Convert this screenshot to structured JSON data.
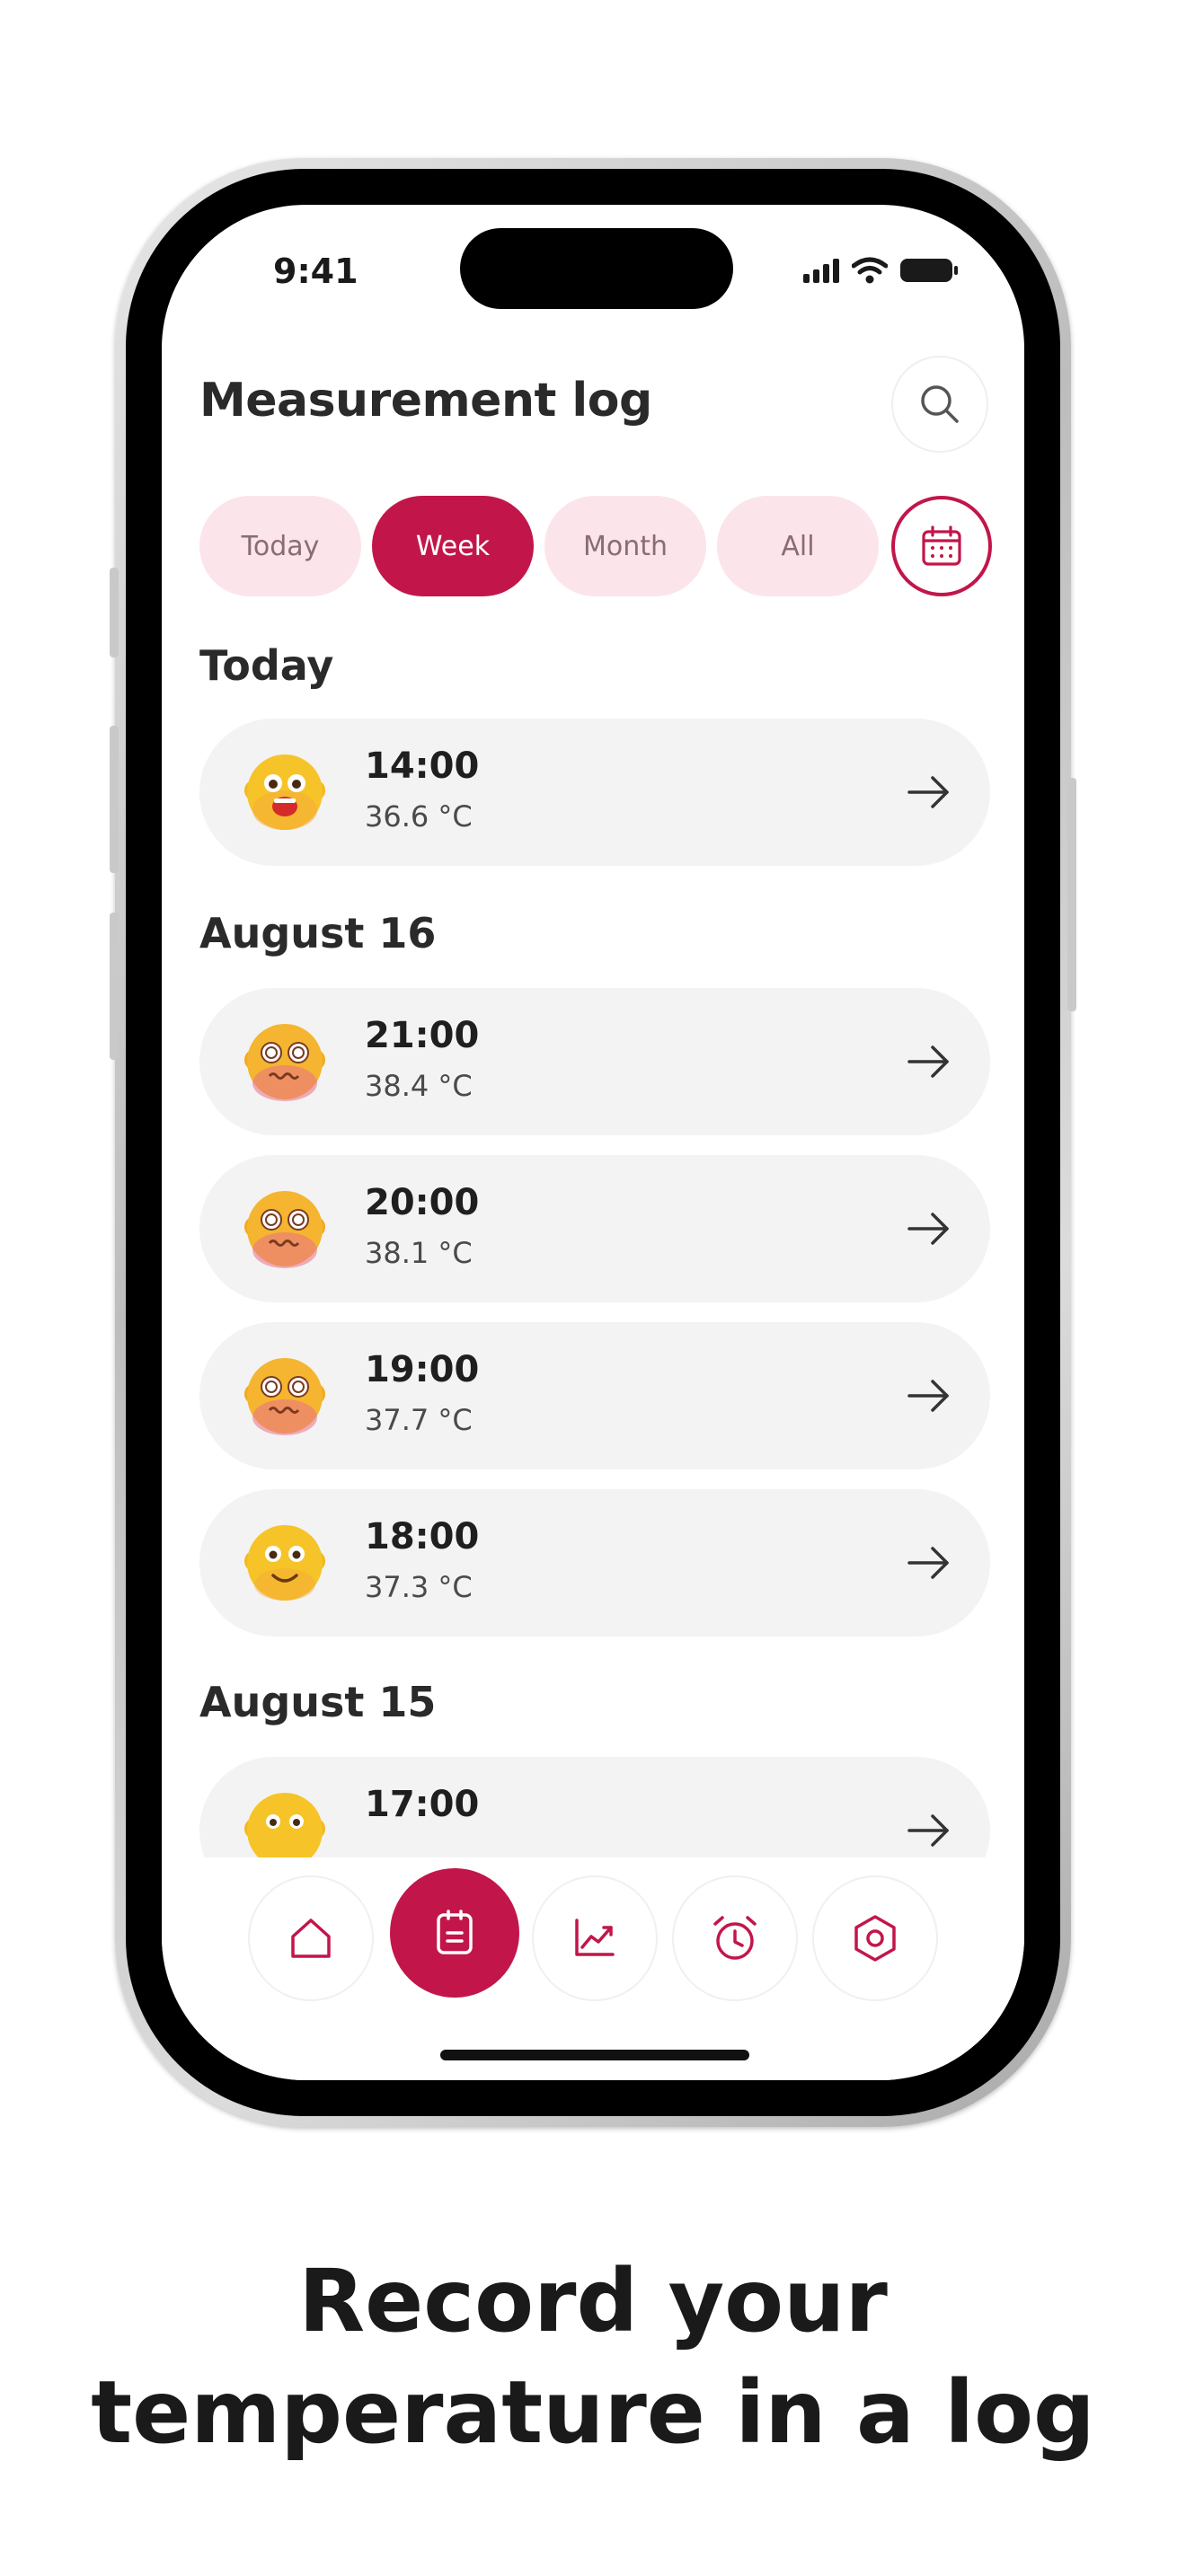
{
  "status_bar": {
    "time": "9:41"
  },
  "header": {
    "title": "Measurement log"
  },
  "filters": {
    "chips": [
      {
        "label": "Today",
        "active": false
      },
      {
        "label": "Week",
        "active": true
      },
      {
        "label": "Month",
        "active": false
      },
      {
        "label": "All",
        "active": false
      }
    ]
  },
  "sections": [
    {
      "title": "Today",
      "entries": [
        {
          "time": "14:00",
          "temp": "36.6 °C",
          "icon": "happy-face-emoji"
        }
      ]
    },
    {
      "title": "August 16",
      "entries": [
        {
          "time": "21:00",
          "temp": "38.4 °C",
          "icon": "dizzy-face-emoji"
        },
        {
          "time": "20:00",
          "temp": "38.1 °C",
          "icon": "dizzy-face-emoji"
        },
        {
          "time": "19:00",
          "temp": "37.7 °C",
          "icon": "dizzy-face-emoji"
        },
        {
          "time": "18:00",
          "temp": "37.3 °C",
          "icon": "smiling-face-emoji"
        }
      ]
    },
    {
      "title": "August 15",
      "entries": [
        {
          "time": "17:00",
          "temp": "",
          "icon": "worried-face-emoji"
        }
      ]
    }
  ],
  "nav": {
    "items": [
      "home-icon",
      "log-icon",
      "chart-icon",
      "alarm-icon",
      "settings-icon"
    ],
    "active": "log-icon"
  },
  "colors": {
    "accent": "#c2164a",
    "chip_bg": "#fbe4ea",
    "card_bg": "#f3f3f3"
  },
  "caption": {
    "line1": "Record your",
    "line2": "temperature in a log"
  }
}
